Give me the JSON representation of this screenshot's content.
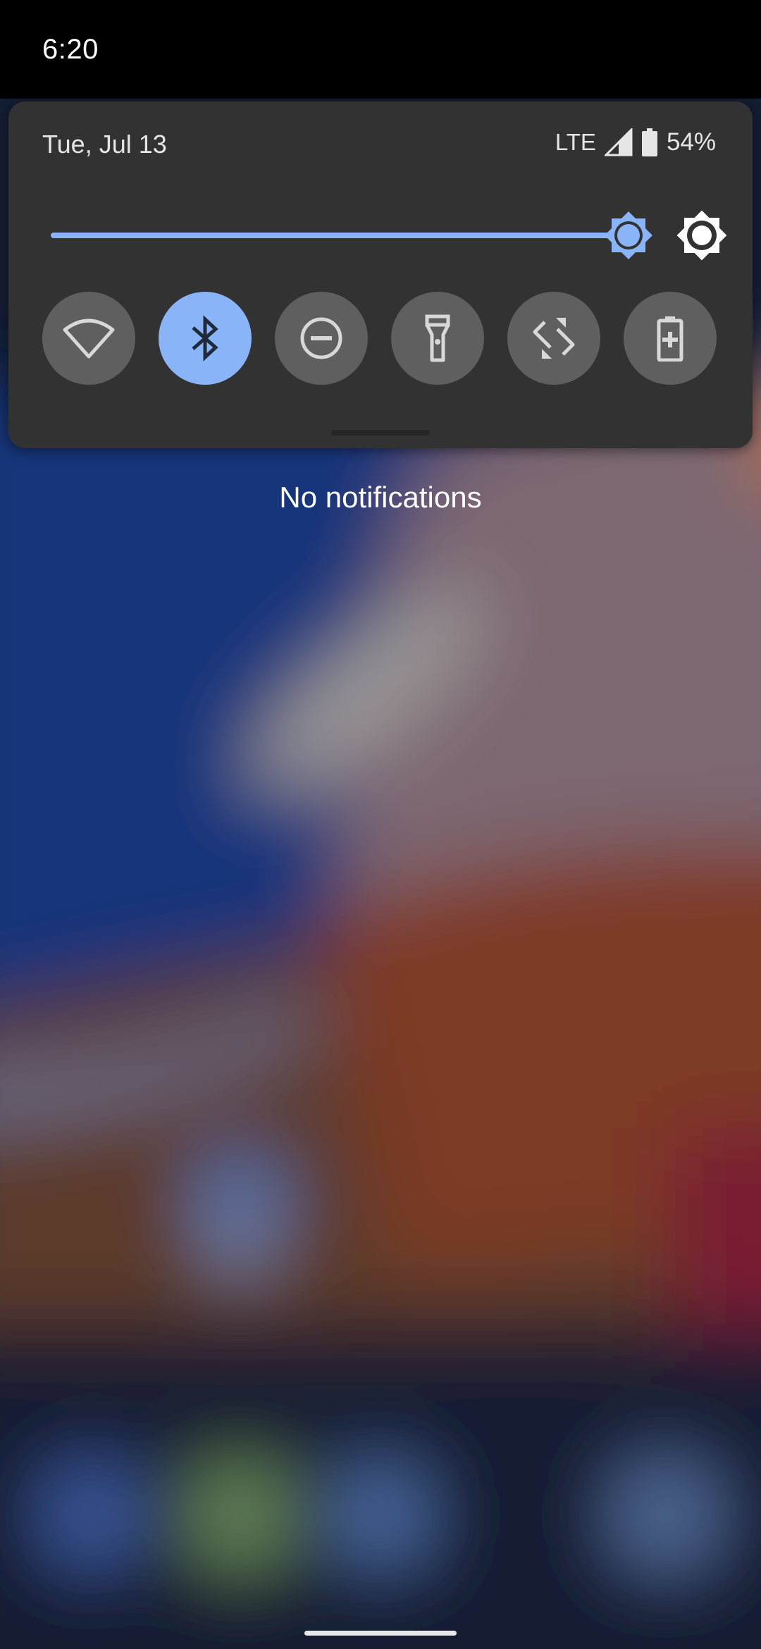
{
  "status_bar": {
    "time": "6:20"
  },
  "quick_settings": {
    "date": "Tue, Jul 13",
    "network": "LTE",
    "battery_percent": "54%",
    "brightness_level": 0.92,
    "tiles": [
      {
        "name": "wifi",
        "icon": "wifi-icon",
        "active": false
      },
      {
        "name": "bluetooth",
        "icon": "bluetooth-icon",
        "active": true
      },
      {
        "name": "do-not-disturb",
        "icon": "do-not-disturb-icon",
        "active": false
      },
      {
        "name": "flashlight",
        "icon": "flashlight-icon",
        "active": false
      },
      {
        "name": "auto-rotate",
        "icon": "auto-rotate-icon",
        "active": false
      },
      {
        "name": "battery-saver",
        "icon": "battery-saver-icon",
        "active": false
      }
    ]
  },
  "notifications": {
    "empty_text": "No notifications"
  },
  "colors": {
    "accent": "#8ab4f8",
    "panel": "#323232",
    "tile_inactive": "#5f5f5f"
  }
}
